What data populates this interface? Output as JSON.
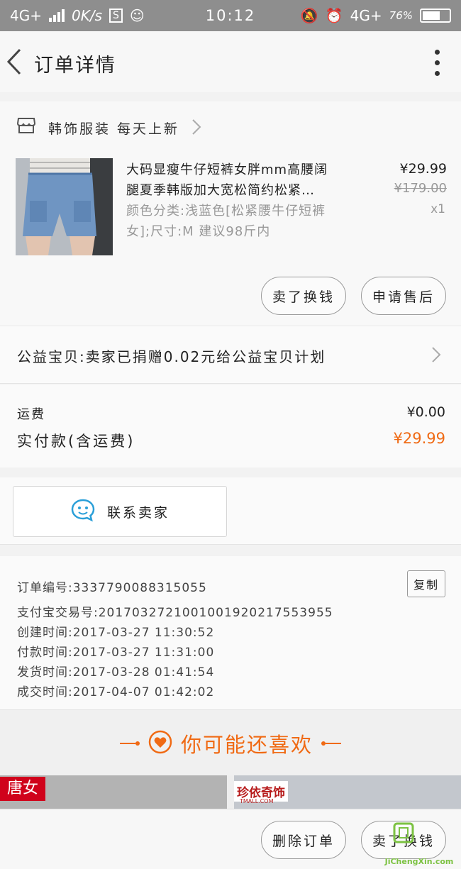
{
  "status_bar": {
    "network_left": "4G+",
    "speed": "0K/s",
    "s_badge": "S",
    "time": "10:12",
    "network_right": "4G+",
    "battery_percent": "76%",
    "battery_level": 0.76
  },
  "nav": {
    "title": "订单详情"
  },
  "shop": {
    "name": "韩饰服装 每天上新"
  },
  "product": {
    "title": "大码显瘦牛仔短裤女胖mm高腰阔腿夏季韩版加大宽松简约松紧…",
    "sku": "颜色分类:浅蓝色[松紧腰牛仔短裤女];尺寸:M 建议98斤内",
    "price": "¥29.99",
    "original_price": "¥179.00",
    "quantity": "x1",
    "btn_exchange": "卖了换钱",
    "btn_aftersale": "申请售后"
  },
  "charity": {
    "text": "公益宝贝:卖家已捐赠0.02元给公益宝贝计划"
  },
  "fees": {
    "shipping_label": "运费",
    "shipping_value": "¥0.00",
    "paid_label": "实付款(含运费)",
    "paid_value": "¥29.99",
    "accent_color": "#f06a14"
  },
  "contact": {
    "label": "联系卖家",
    "icon": "chat-bubble-icon",
    "icon_color": "#2a9fd8"
  },
  "order_info": {
    "order_no": "订单编号:3337790088315055",
    "copy_label": "复制",
    "alipay_no": "支付宝交易号:2017032721001001920217553955",
    "created": "创建时间:2017-03-27 11:30:52",
    "paid": "付款时间:2017-03-27 11:31:00",
    "shipped": "发货时间:2017-03-28 01:41:54",
    "completed": "成交时间:2017-04-07 01:42:02"
  },
  "recommend": {
    "title": "你可能还喜欢"
  },
  "cards": {
    "card1_brand": "唐女",
    "card2_brand": "珍依奇饰",
    "card2_sub": "TMALL.COM"
  },
  "bottom": {
    "btn_delete": "删除订单",
    "btn_exchange": "卖了换钱"
  },
  "watermark": {
    "url": "JiChengXin.com"
  }
}
